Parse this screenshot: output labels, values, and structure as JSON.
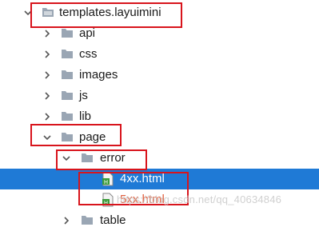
{
  "tree": {
    "root": {
      "label": "templates.layuimini"
    },
    "items": [
      {
        "label": "api"
      },
      {
        "label": "css"
      },
      {
        "label": "images"
      },
      {
        "label": "js"
      },
      {
        "label": "lib"
      },
      {
        "label": "page"
      }
    ],
    "error_folder": {
      "label": "error"
    },
    "files": [
      {
        "label": "4xx.html"
      },
      {
        "label": "5xx.html"
      }
    ],
    "partial_next": {
      "label": "table"
    }
  },
  "watermark": {
    "text": "https://blog.csdn.net/qq_40634846"
  },
  "colors": {
    "selection": "#1f7ad6",
    "highlight_box": "#d8141c",
    "folder": "#9aa6b4",
    "html_file": "#3a9a3a"
  }
}
